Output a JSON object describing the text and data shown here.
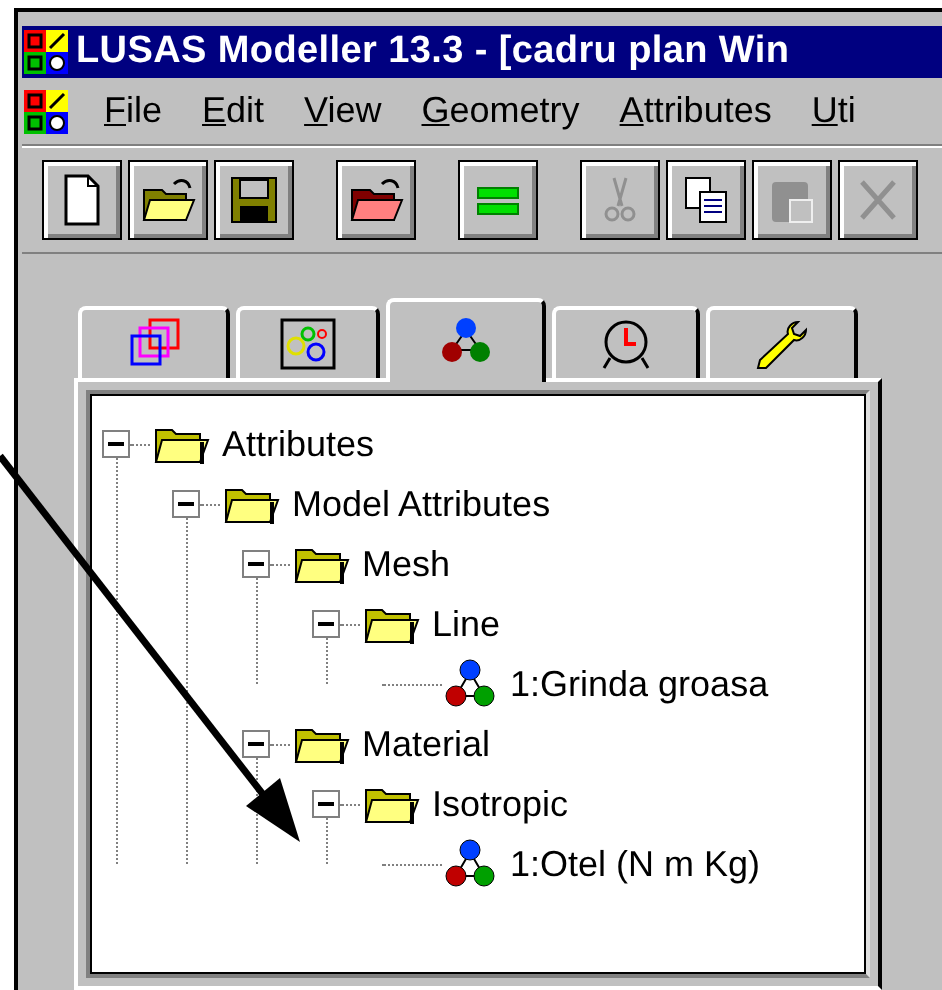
{
  "window": {
    "title": "LUSAS Modeller 13.3 - [cadru plan Win"
  },
  "menu": [
    {
      "label": "File"
    },
    {
      "label": "Edit"
    },
    {
      "label": "View"
    },
    {
      "label": "Geometry"
    },
    {
      "label": "Attributes"
    },
    {
      "label": "Uti"
    }
  ],
  "toolbar": [
    {
      "kind": "new",
      "disabled": false,
      "separator_before": false
    },
    {
      "kind": "open",
      "disabled": false,
      "separator_before": false
    },
    {
      "kind": "save",
      "disabled": false,
      "separator_before": false
    },
    {
      "kind": "open-red",
      "disabled": false,
      "separator_before": true
    },
    {
      "kind": "equals",
      "disabled": false,
      "separator_before": true
    },
    {
      "kind": "cut",
      "disabled": true,
      "separator_before": true
    },
    {
      "kind": "copy",
      "disabled": false,
      "separator_before": false
    },
    {
      "kind": "paste",
      "disabled": true,
      "separator_before": false
    },
    {
      "kind": "delete",
      "disabled": true,
      "separator_before": false
    }
  ],
  "tabs": [
    {
      "kind": "layers",
      "selected": false
    },
    {
      "kind": "groups",
      "selected": false
    },
    {
      "kind": "attributes",
      "selected": true
    },
    {
      "kind": "clock",
      "selected": false
    },
    {
      "kind": "wrench",
      "selected": false
    }
  ],
  "tree": [
    {
      "label": "Attributes",
      "kind": "folder",
      "expanded": true,
      "children": [
        {
          "label": "Model Attributes",
          "kind": "folder",
          "expanded": true,
          "children": [
            {
              "label": "Mesh",
              "kind": "folder",
              "expanded": true,
              "children": [
                {
                  "label": "Line",
                  "kind": "folder",
                  "expanded": true,
                  "children": [
                    {
                      "label": "1:Grinda groasa",
                      "kind": "attribute"
                    }
                  ]
                }
              ]
            },
            {
              "label": "Material",
              "kind": "folder",
              "expanded": true,
              "children": [
                {
                  "label": "Isotropic",
                  "kind": "folder",
                  "expanded": true,
                  "children": [
                    {
                      "label": "1:Otel (N m Kg)",
                      "kind": "attribute"
                    }
                  ]
                }
              ]
            }
          ]
        }
      ]
    }
  ],
  "annotation": {
    "kind": "arrow"
  }
}
